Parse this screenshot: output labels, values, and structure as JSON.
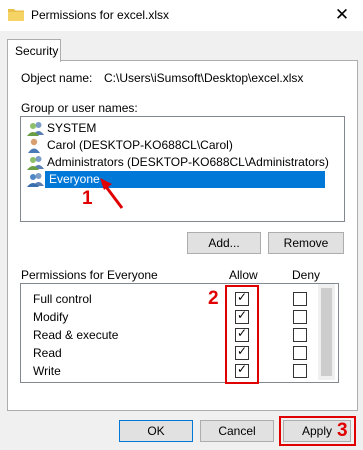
{
  "window": {
    "title": "Permissions for excel.xlsx"
  },
  "tabs": [
    {
      "label": "Security"
    }
  ],
  "object": {
    "label": "Object name:",
    "value": "C:\\Users\\iSumsoft\\Desktop\\excel.xlsx"
  },
  "groups": {
    "label": "Group or user names:",
    "items": [
      {
        "name": "SYSTEM",
        "icon": "users-icon"
      },
      {
        "name": "Carol (DESKTOP-KO688CL\\Carol)",
        "icon": "user-icon"
      },
      {
        "name": "Administrators (DESKTOP-KO688CL\\Administrators)",
        "icon": "users-icon"
      },
      {
        "name": "Everyone",
        "icon": "users-icon",
        "selected": true
      }
    ],
    "add_label": "Add...",
    "remove_label": "Remove"
  },
  "permissions": {
    "label": "Permissions for Everyone",
    "allow_header": "Allow",
    "deny_header": "Deny",
    "rows": [
      {
        "name": "Full control",
        "allow": true,
        "deny": false
      },
      {
        "name": "Modify",
        "allow": true,
        "deny": false
      },
      {
        "name": "Read & execute",
        "allow": true,
        "deny": false
      },
      {
        "name": "Read",
        "allow": true,
        "deny": false
      },
      {
        "name": "Write",
        "allow": true,
        "deny": false
      }
    ]
  },
  "footer": {
    "ok_label": "OK",
    "cancel_label": "Cancel",
    "apply_label": "Apply"
  },
  "annotations": {
    "one": "1",
    "two": "2",
    "three": "3",
    "color": "#e00000"
  },
  "colors": {
    "selection": "#0078d7",
    "button": "#e1e1e1"
  }
}
